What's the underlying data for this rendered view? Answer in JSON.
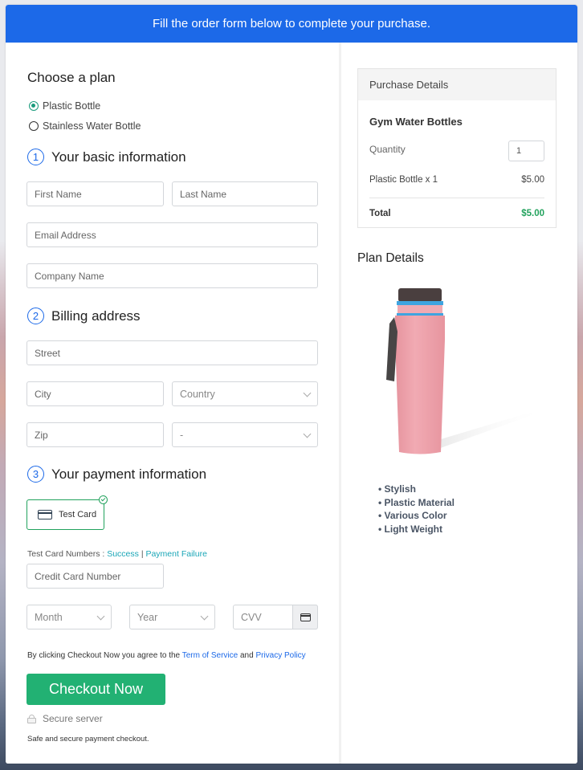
{
  "banner": {
    "text": "Fill the order form below to complete your purchase."
  },
  "plan": {
    "heading": "Choose a plan",
    "options": [
      {
        "label": "Plastic Bottle",
        "selected": true
      },
      {
        "label": "Stainless Water Bottle",
        "selected": false
      }
    ]
  },
  "basic_info": {
    "number": "1",
    "heading": "Your basic information",
    "first_name_placeholder": "First Name",
    "last_name_placeholder": "Last Name",
    "email_placeholder": "Email Address",
    "company_placeholder": "Company Name"
  },
  "billing": {
    "number": "2",
    "heading": "Billing address",
    "street_placeholder": "Street",
    "city_placeholder": "City",
    "country_selected": "Country",
    "zip_placeholder": "Zip",
    "state_selected": "-"
  },
  "payment": {
    "number": "3",
    "heading": "Your payment information",
    "method_label": "Test Card",
    "test_numbers_label": "Test Card Numbers :",
    "success_link": "Success",
    "separator": "|",
    "failure_link": "Payment Failure",
    "card_number_placeholder": "Credit Card Number",
    "month_selected": "Month",
    "year_selected": "Year",
    "cvv_placeholder": "CVV"
  },
  "agreement": {
    "prefix": "By clicking Checkout Now you agree to the",
    "tos_link": "Term of Service",
    "and": "and",
    "privacy_link": "Privacy Policy"
  },
  "checkout_button": "Checkout Now",
  "secure_label": "Secure server",
  "safe_note": "Safe and secure payment checkout.",
  "purchase_details": {
    "heading": "Purchase Details",
    "product": "Gym Water Bottles",
    "quantity_label": "Quantity",
    "quantity_value": "1",
    "line_item": "Plastic Bottle x 1",
    "line_price": "$5.00",
    "total_label": "Total",
    "total_value": "$5.00"
  },
  "plan_details": {
    "heading": "Plan Details",
    "image_alt": "Pink plastic gym water bottle",
    "features": [
      "Stylish",
      "Plastic Material",
      "Various Color",
      "Light Weight"
    ]
  },
  "colors": {
    "primary": "#1c69e8",
    "success": "#22b173",
    "total": "#22a25d",
    "link_teal": "#1aa6b7"
  }
}
